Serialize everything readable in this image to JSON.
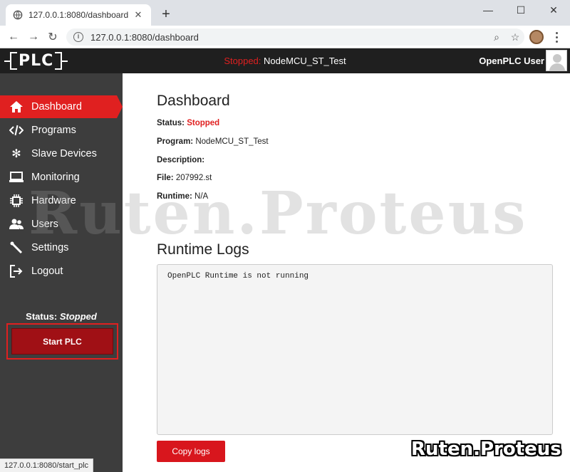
{
  "browser": {
    "tab_title": "127.0.0.1:8080/dashboard",
    "tab_close": "✕",
    "new_tab": "+",
    "url": "127.0.0.1:8080/dashboard",
    "status_url": "127.0.0.1:8080/start_plc",
    "window_controls": [
      "—",
      "☐",
      "✕"
    ]
  },
  "appbar": {
    "logo_text": "PLC",
    "status_label": "Stopped:",
    "program_name": "NodeMCU_ST_Test",
    "user_name": "OpenPLC User"
  },
  "sidebar": {
    "items": [
      {
        "label": "Dashboard",
        "icon": "home-icon",
        "active": true
      },
      {
        "label": "Programs",
        "icon": "code-icon",
        "active": false
      },
      {
        "label": "Slave Devices",
        "icon": "gear-cluster-icon",
        "active": false
      },
      {
        "label": "Monitoring",
        "icon": "monitor-icon",
        "active": false
      },
      {
        "label": "Hardware",
        "icon": "chip-icon",
        "active": false
      },
      {
        "label": "Users",
        "icon": "users-icon",
        "active": false
      },
      {
        "label": "Settings",
        "icon": "wrench-icon",
        "active": false
      },
      {
        "label": "Logout",
        "icon": "logout-icon",
        "active": false
      }
    ],
    "status_label": "Status:",
    "status_value": "Stopped",
    "start_button": "Start PLC"
  },
  "main": {
    "title": "Dashboard",
    "fields": {
      "status_label": "Status:",
      "status_value": "Stopped",
      "program_label": "Program:",
      "program_value": "NodeMCU_ST_Test",
      "description_label": "Description:",
      "description_value": "",
      "file_label": "File:",
      "file_value": "207992.st",
      "runtime_label": "Runtime:",
      "runtime_value": "N/A"
    },
    "logs_title": "Runtime Logs",
    "logs_text": "OpenPLC Runtime is not running",
    "copy_button": "Copy logs"
  },
  "watermark": {
    "big": "Ruten.Proteus",
    "small": "Ruten.Proteus"
  },
  "colors": {
    "accent_red": "#e02020",
    "sidebar_bg": "#3d3d3d",
    "appbar_bg": "#1f1f1f"
  }
}
